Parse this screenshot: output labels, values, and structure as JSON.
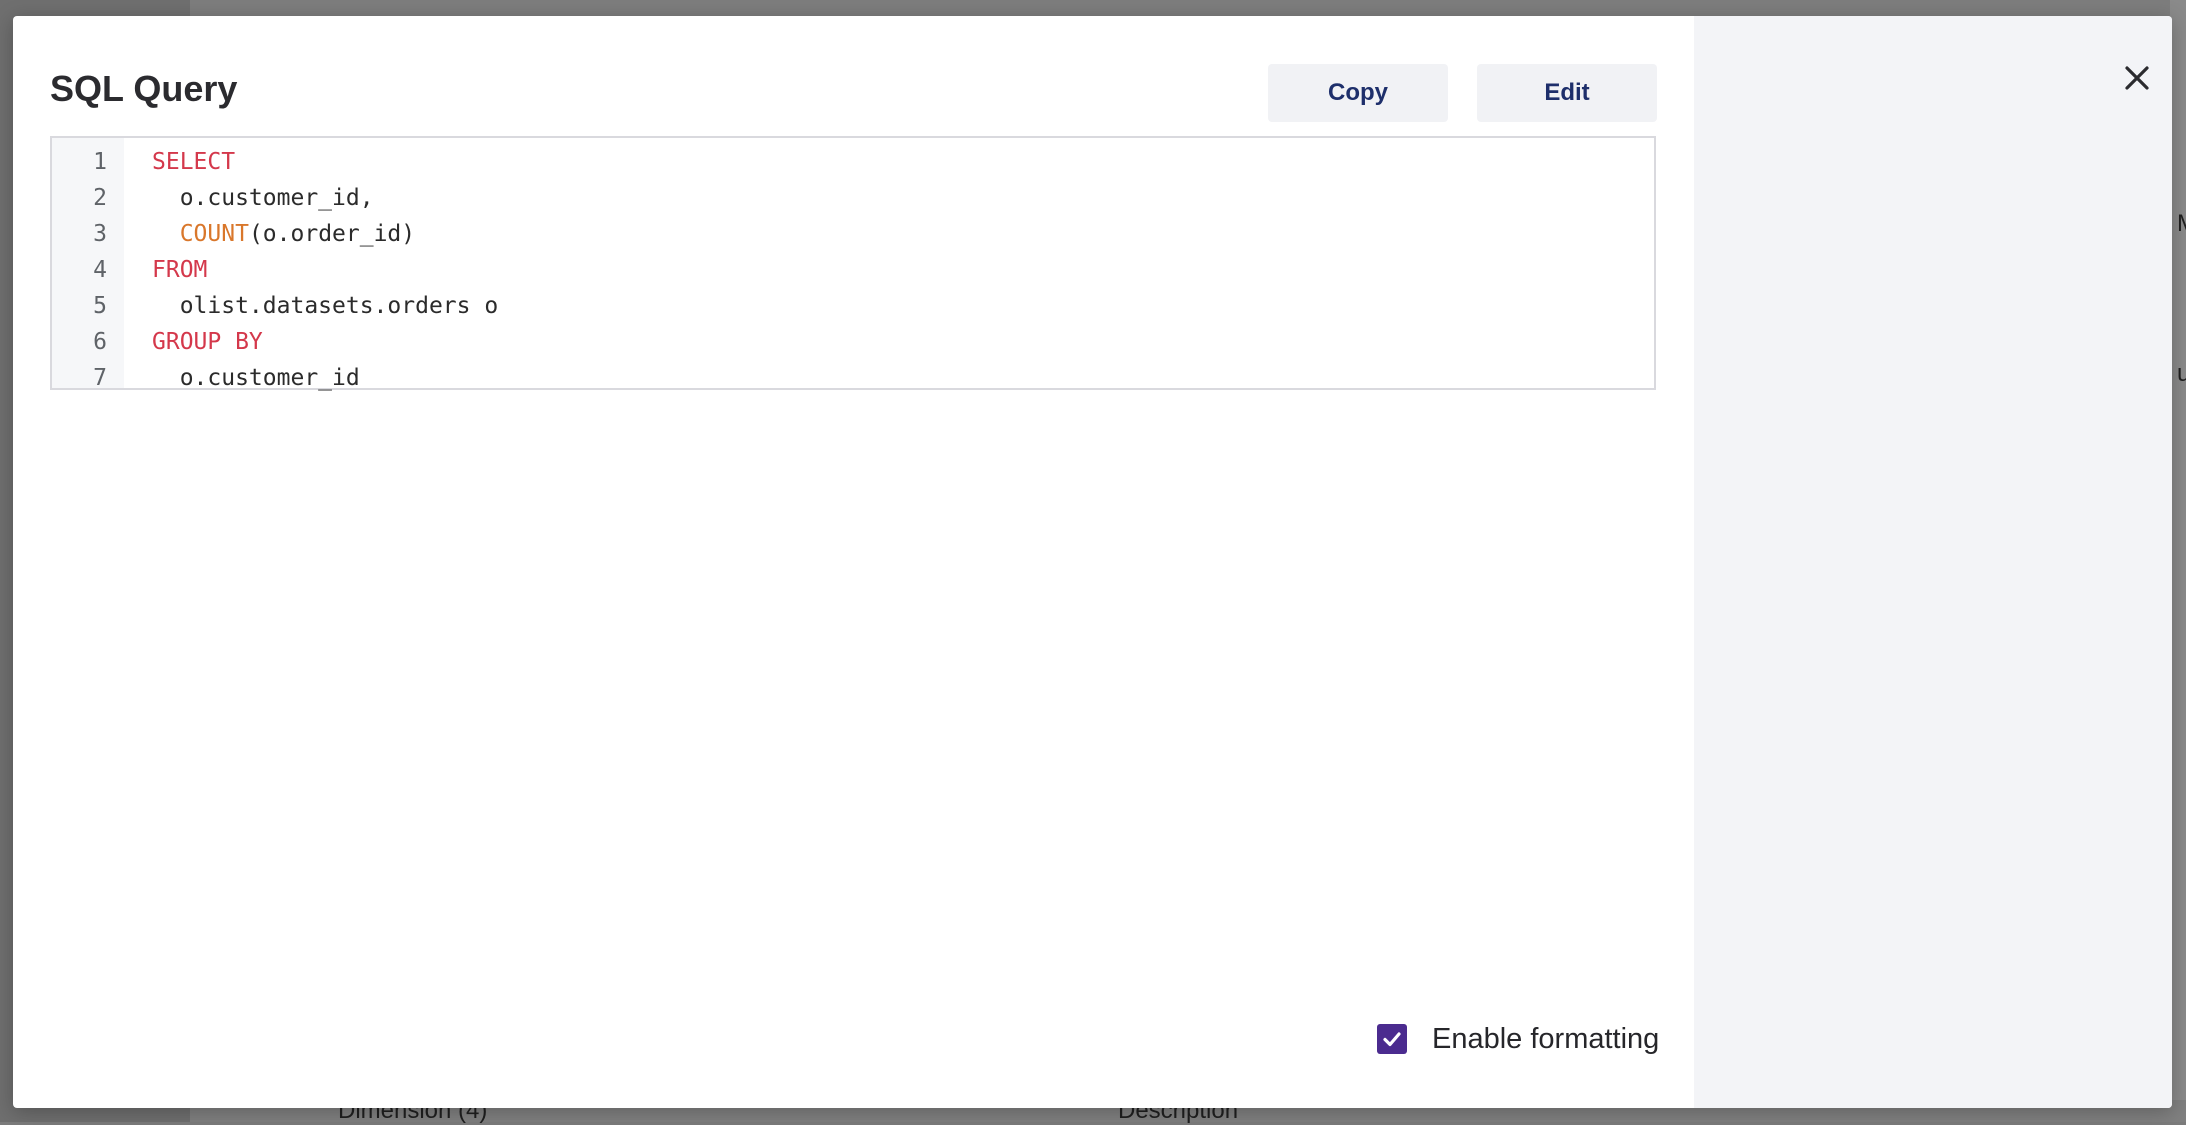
{
  "background": {
    "bottom_column_1": "Dimension (4)",
    "bottom_column_2": "Description",
    "edge_text_1": "M",
    "edge_text_2": "ut"
  },
  "modal": {
    "title": "SQL Query",
    "copy_label": "Copy",
    "edit_label": "Edit",
    "close_icon": "close-icon",
    "formatting_label": "Enable formatting",
    "formatting_enabled": true
  },
  "editor": {
    "lines": [
      {
        "number": "1",
        "segments": [
          {
            "t": "SELECT",
            "k": "kw"
          }
        ]
      },
      {
        "number": "2",
        "segments": [
          {
            "t": "  o.customer_id,",
            "k": "plain"
          }
        ]
      },
      {
        "number": "3",
        "segments": [
          {
            "t": "  ",
            "k": "plain"
          },
          {
            "t": "COUNT",
            "k": "fn"
          },
          {
            "t": "(o.order_id)",
            "k": "plain"
          }
        ]
      },
      {
        "number": "4",
        "segments": [
          {
            "t": "FROM",
            "k": "kw"
          }
        ]
      },
      {
        "number": "5",
        "segments": [
          {
            "t": "  olist.datasets.orders o",
            "k": "plain"
          }
        ]
      },
      {
        "number": "6",
        "segments": [
          {
            "t": "GROUP BY",
            "k": "kw"
          }
        ]
      },
      {
        "number": "7",
        "segments": [
          {
            "t": "  o.customer_id",
            "k": "plain"
          }
        ]
      }
    ]
  },
  "colors": {
    "keyword": "#d4384b",
    "function": "#d9772b",
    "checkbox": "#4b2b8f",
    "button_text": "#1e2f6b"
  }
}
